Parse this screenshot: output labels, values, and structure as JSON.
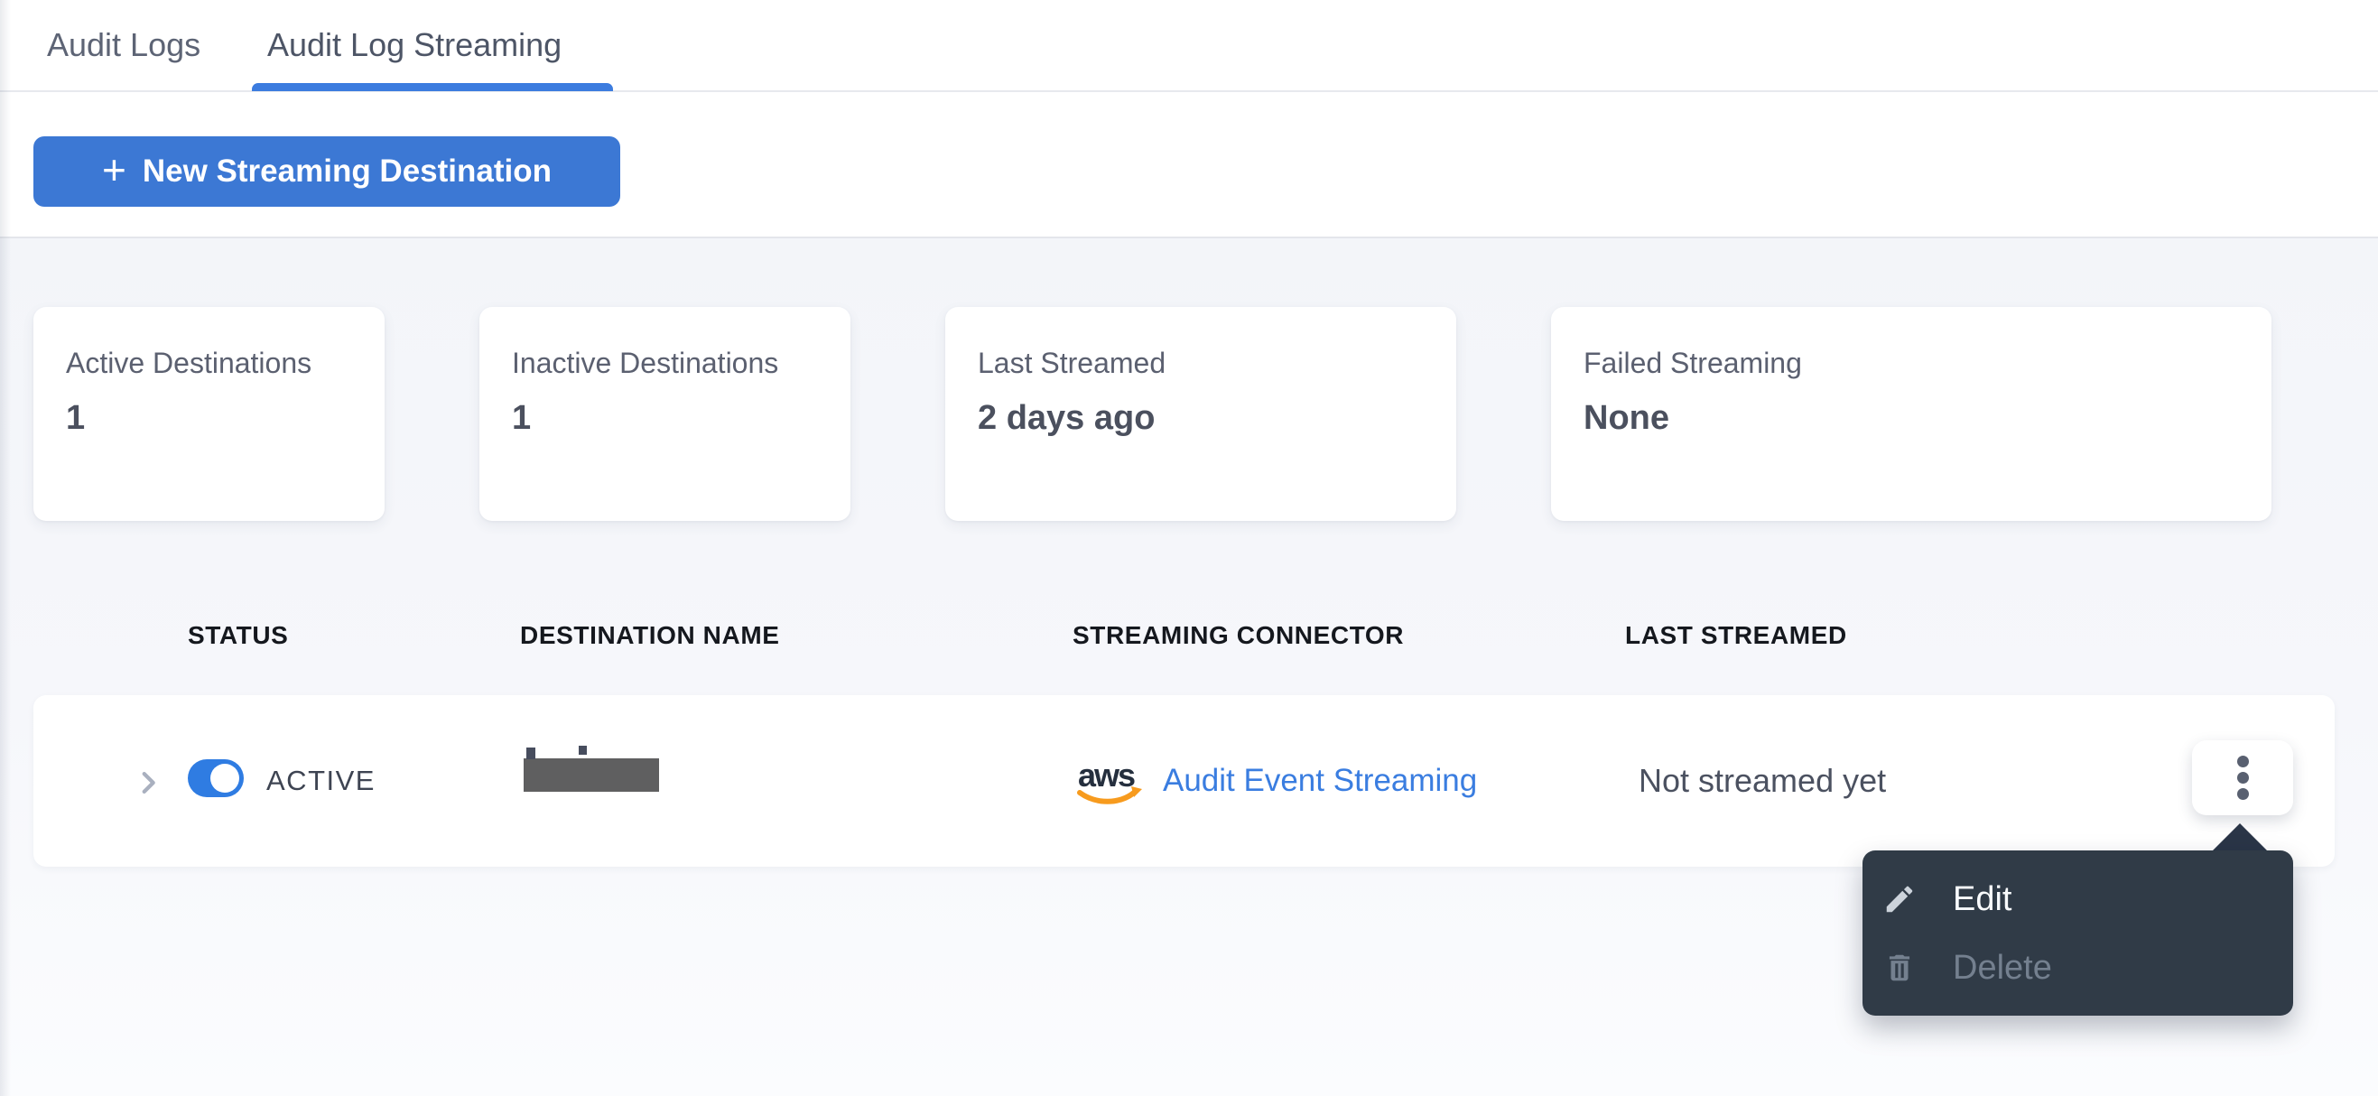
{
  "tabs": {
    "audit_logs": "Audit Logs",
    "audit_log_streaming": "Audit Log Streaming"
  },
  "toolbar": {
    "plus_glyph": "+",
    "new_destination_button": "New Streaming Destination"
  },
  "stats": [
    {
      "label": "Active Destinations",
      "value": "1"
    },
    {
      "label": "Inactive Destinations",
      "value": "1"
    },
    {
      "label": "Last Streamed",
      "value": "2 days ago"
    },
    {
      "label": "Failed Streaming",
      "value": "None"
    }
  ],
  "table": {
    "columns": [
      "STATUS",
      "DESTINATION NAME",
      "STREAMING CONNECTOR",
      "LAST STREAMED"
    ],
    "row": {
      "status_label": "ACTIVE",
      "toggle_state": "on",
      "destination_name_redacted": true,
      "connector_logo_text": "aws",
      "connector_link": "Audit Event Streaming",
      "last_streamed": "Not streamed yet"
    }
  },
  "context_menu": {
    "items": [
      {
        "label": "Edit",
        "icon": "pencil-icon",
        "enabled": true
      },
      {
        "label": "Delete",
        "icon": "trash-icon",
        "enabled": false
      }
    ]
  },
  "colors": {
    "accent_blue": "#3c78d4",
    "tab_underline_blue": "#3c7cdf",
    "link_blue": "#3a7de0",
    "toggle_blue": "#2f7ce2",
    "menu_bg": "#303b47",
    "page_bg": "#f5f6fa",
    "aws_orange": "#f79b1e",
    "redaction_gray": "#5f5f60"
  }
}
